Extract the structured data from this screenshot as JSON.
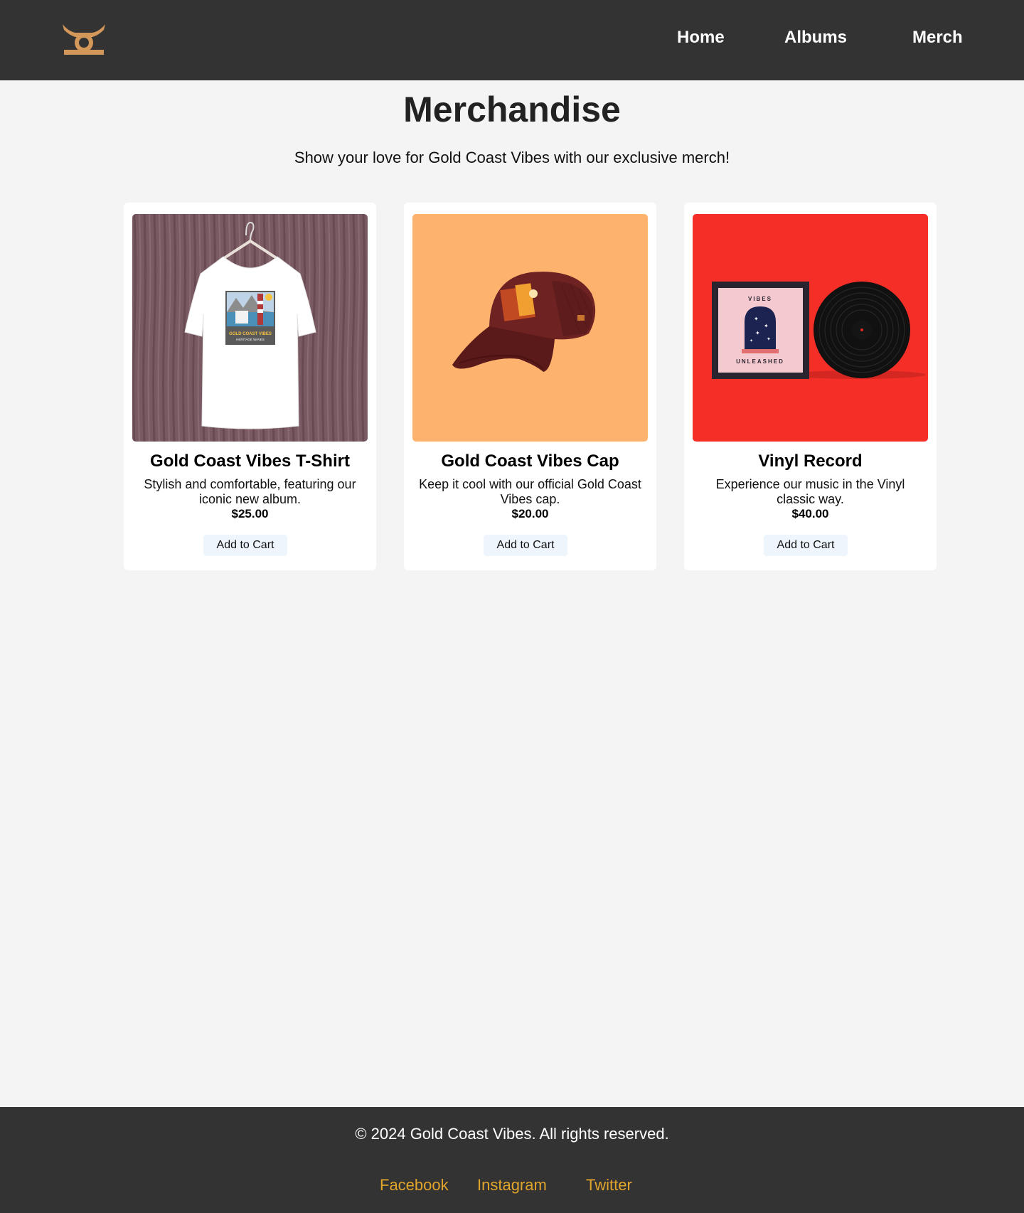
{
  "nav": {
    "links": [
      {
        "label": "Home"
      },
      {
        "label": "Albums"
      },
      {
        "label": "Merch"
      }
    ]
  },
  "main": {
    "title": "Merchandise",
    "subtitle": "Show your love for Gold Coast Vibes with our exclusive merch!",
    "products": [
      {
        "name": "Gold Coast Vibes T-Shirt",
        "description": "Stylish and comfortable, featuring our iconic new album.",
        "price": "$25.00",
        "button": "Add to Cart",
        "image_colors": {
          "background": "#7a5a62",
          "item": "#ffffff"
        }
      },
      {
        "name": "Gold Coast Vibes Cap",
        "description": "Keep it cool with our official Gold Coast Vibes cap.",
        "price": "$20.00",
        "button": "Add to Cart",
        "image_colors": {
          "background": "#fdb36d",
          "item": "#6e2222"
        }
      },
      {
        "name": "Vinyl Record",
        "description": "Experience our music in the Vinyl classic way.",
        "price": "$40.00",
        "button": "Add to Cart",
        "image_colors": {
          "background": "#f52f28",
          "item": "#111111"
        }
      }
    ],
    "artwork_text": {
      "shirt_line1": "GOLD COAST VIBES",
      "shirt_line2": "HERITAGE WAVES",
      "cover_top": "VIBES",
      "cover_bottom": "UNLEASHED"
    }
  },
  "footer": {
    "copyright": "© 2024 Gold Coast Vibes. All rights reserved.",
    "social": [
      {
        "label": "Facebook"
      },
      {
        "label": "Instagram"
      },
      {
        "label": "Twitter"
      }
    ]
  },
  "colors": {
    "header_bg": "#333333",
    "page_bg": "#f4f4f4",
    "logo": "#d4975a",
    "social_link": "#e2a52b",
    "button_bg": "#eef5fc"
  }
}
